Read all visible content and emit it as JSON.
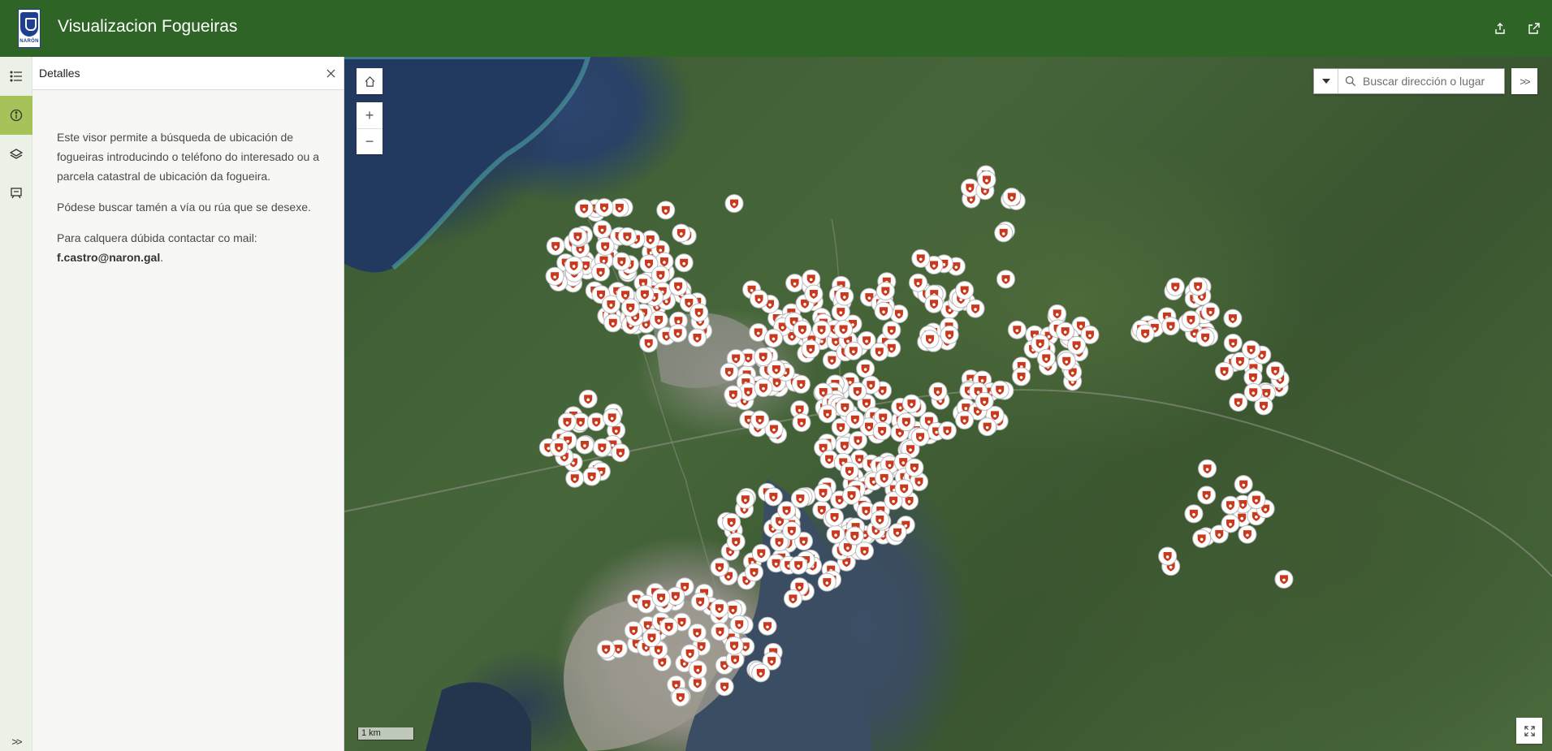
{
  "header": {
    "title": "Visualizacion Fogueiras",
    "logo_text": "NARÓN",
    "share_icon": "share-icon",
    "open_icon": "open-in-new-icon",
    "color": "#2f6427"
  },
  "rail": {
    "items": [
      {
        "name": "legend",
        "icon": "list-icon"
      },
      {
        "name": "details",
        "icon": "info-icon",
        "active": true
      },
      {
        "name": "layers",
        "icon": "layers-icon"
      },
      {
        "name": "basemap",
        "icon": "basemap-icon"
      }
    ],
    "active_color": "#a6c35a"
  },
  "panel": {
    "title": "Detalles",
    "paragraph_1": "Este visor permite a búsqueda de ubicación de fogueiras introducindo o teléfono do interesado ou a parcela catastral de ubicación da fogueira.",
    "paragraph_2": "Pódese buscar tamén a vía ou rúa que se desexe.",
    "paragraph_3_prefix": "Para calquera dúbida contactar co mail:",
    "email": "f.castro@naron.gal",
    "paragraph_3_suffix": "."
  },
  "map": {
    "search_placeholder": "Buscar dirección o lugar",
    "zoom_in": "+",
    "zoom_out": "−",
    "scale_label": "1 km",
    "expand_label": ">>",
    "marker_icon": "fire-marker-icon",
    "marker_color": "#c8391d"
  }
}
